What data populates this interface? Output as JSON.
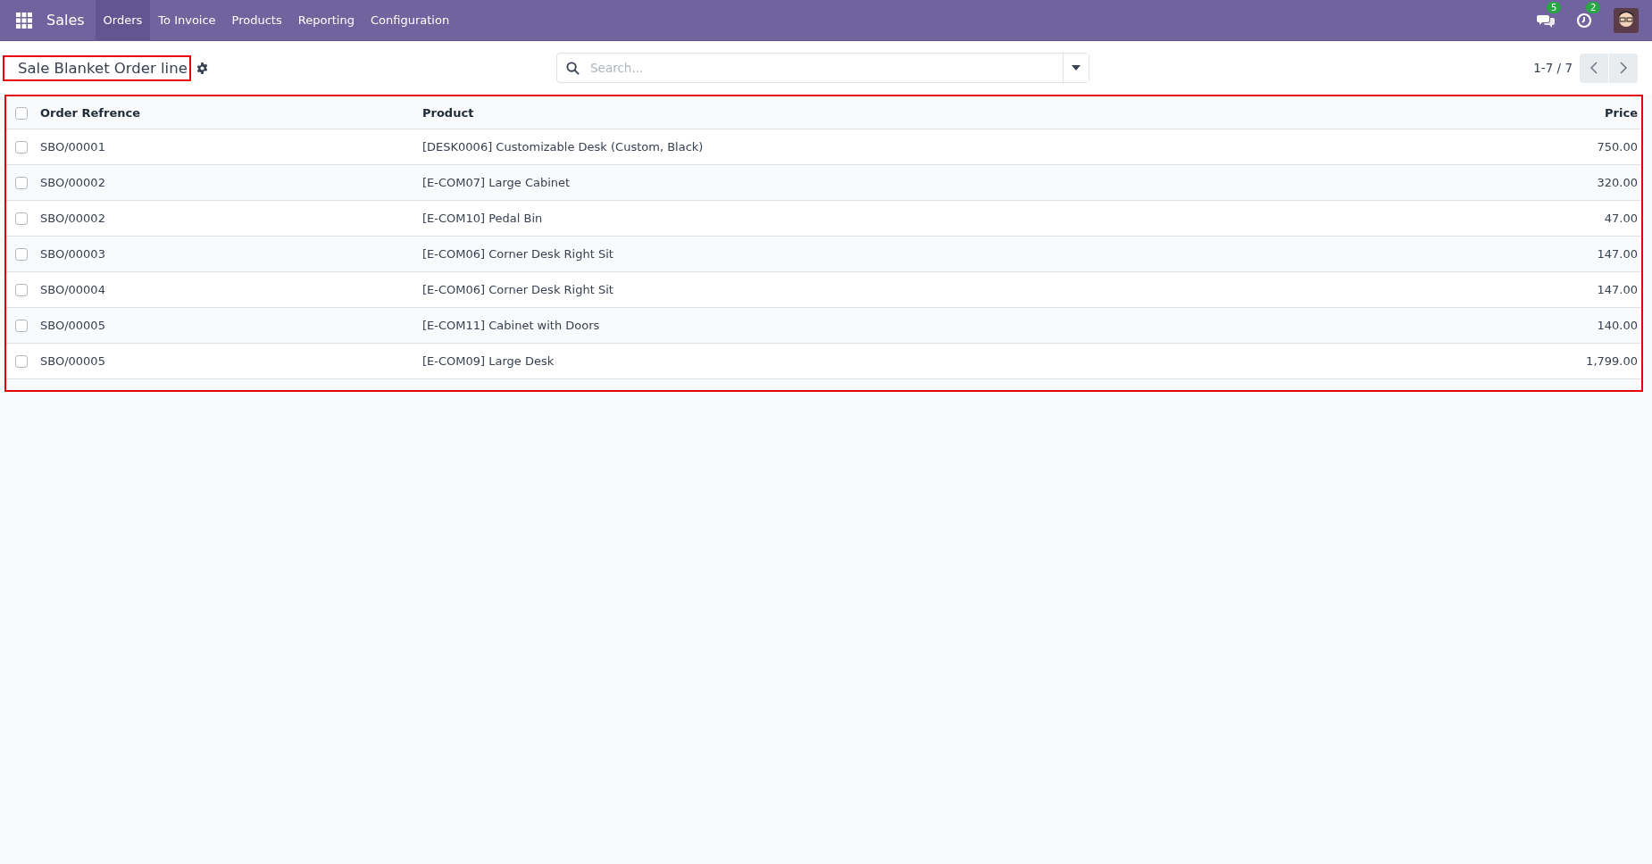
{
  "navbar": {
    "app_name": "Sales",
    "menu": [
      {
        "label": "Orders",
        "selected": true
      },
      {
        "label": "To Invoice",
        "selected": false
      },
      {
        "label": "Products",
        "selected": false
      },
      {
        "label": "Reporting",
        "selected": false
      },
      {
        "label": "Configuration",
        "selected": false
      }
    ],
    "messages_badge": "5",
    "activities_badge": "2"
  },
  "control_panel": {
    "title": "Sale Blanket Order line",
    "title_highlighted": true,
    "search": {
      "placeholder": "Search..."
    },
    "pager": "1-7 / 7"
  },
  "table": {
    "highlighted": true,
    "select_all_checked": false,
    "columns": [
      {
        "label": "Order Refrence"
      },
      {
        "label": "Product"
      },
      {
        "label": "Price"
      }
    ],
    "rows": [
      {
        "checked": false,
        "cells": [
          "SBO/00001",
          "[DESK0006] Customizable Desk (Custom, Black)",
          "750.00"
        ]
      },
      {
        "checked": false,
        "cells": [
          "SBO/00002",
          "[E-COM07] Large Cabinet",
          "320.00"
        ]
      },
      {
        "checked": false,
        "cells": [
          "SBO/00002",
          "[E-COM10] Pedal Bin",
          "47.00"
        ]
      },
      {
        "checked": false,
        "cells": [
          "SBO/00003",
          "[E-COM06] Corner Desk Right Sit",
          "147.00"
        ]
      },
      {
        "checked": false,
        "cells": [
          "SBO/00004",
          "[E-COM06] Corner Desk Right Sit",
          "147.00"
        ]
      },
      {
        "checked": false,
        "cells": [
          "SBO/00005",
          "[E-COM11] Cabinet with Doors",
          "140.00"
        ]
      },
      {
        "checked": false,
        "cells": [
          "SBO/00005",
          "[E-COM09] Large Desk",
          "1,799.00"
        ]
      }
    ]
  }
}
